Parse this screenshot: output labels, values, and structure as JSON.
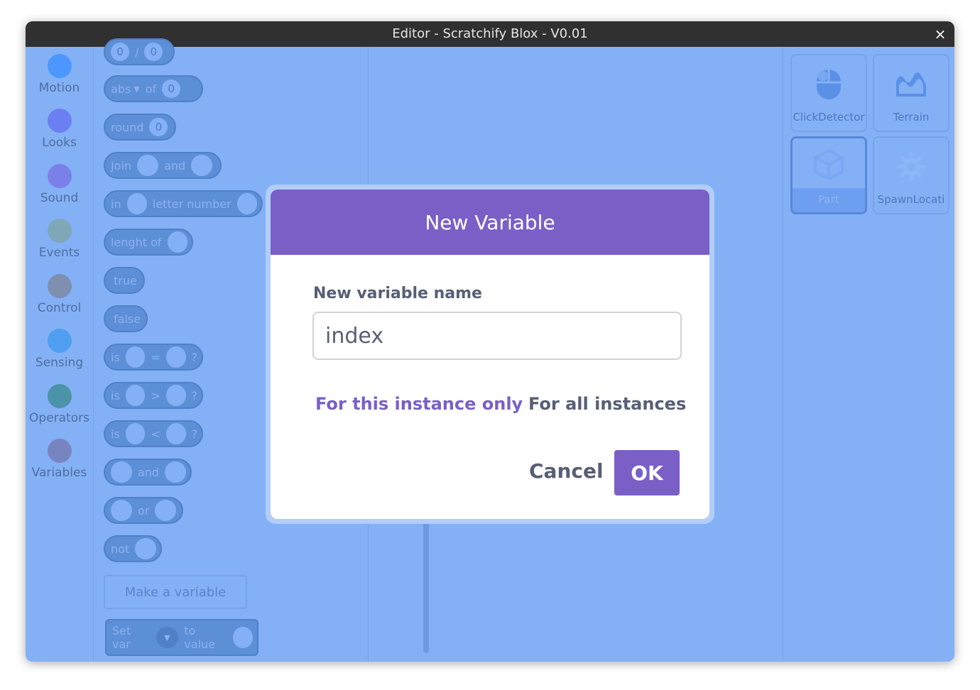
{
  "window": {
    "title": "Editor - Scratchify Blox - V0.01",
    "close_glyph": "×"
  },
  "categories": [
    {
      "label": "Motion",
      "color": "#4c97ff"
    },
    {
      "label": "Looks",
      "color": "#6c7ff2"
    },
    {
      "label": "Sound",
      "color": "#7b7fe8"
    },
    {
      "label": "Events",
      "color": "#7fa7b8"
    },
    {
      "label": "Control",
      "color": "#7f8fb0"
    },
    {
      "label": "Sensing",
      "color": "#4f9ef2"
    },
    {
      "label": "Operators",
      "color": "#4b93a8"
    },
    {
      "label": "Variables",
      "color": "#7884c0"
    }
  ],
  "palette": {
    "div_block": {
      "a": "0",
      "sep": "/",
      "b": "0"
    },
    "abs_block": {
      "func": "abs",
      "caret": "▼",
      "of": "of",
      "value": "0"
    },
    "round_block": {
      "label": "round",
      "value": "0"
    },
    "join_block": {
      "label": "Join",
      "and": "and"
    },
    "letter_block": {
      "in": "in",
      "label": "letter number"
    },
    "length_block": {
      "label": "lenght of"
    },
    "true_block": {
      "label": "true"
    },
    "false_block": {
      "label": "false"
    },
    "eq_block": {
      "is": "is",
      "op": "=",
      "q": "?"
    },
    "gt_block": {
      "is": "is",
      "op": ">",
      "q": "?"
    },
    "lt_block": {
      "is": "is",
      "op": "<",
      "q": "?"
    },
    "and_block": {
      "label": "and"
    },
    "or_block": {
      "label": "or"
    },
    "not_block": {
      "label": "not"
    },
    "make_variable": "Make a variable",
    "setvar_block": {
      "label": "Set var",
      "caret": "▼",
      "to": "to value"
    }
  },
  "sprites": [
    {
      "label": "ClickDetector",
      "icon": "mouse-icon"
    },
    {
      "label": "Terrain",
      "icon": "terrain-icon"
    },
    {
      "label": "Part",
      "icon": "cube-icon",
      "selected": true
    },
    {
      "label": "SpawnLocati",
      "icon": "gear-icon"
    }
  ],
  "modal": {
    "title": "New Variable",
    "field_label": "New variable name",
    "input_value": "index",
    "option_this": "For this instance only",
    "option_all": "For all instances",
    "cancel": "Cancel",
    "ok": "OK"
  }
}
